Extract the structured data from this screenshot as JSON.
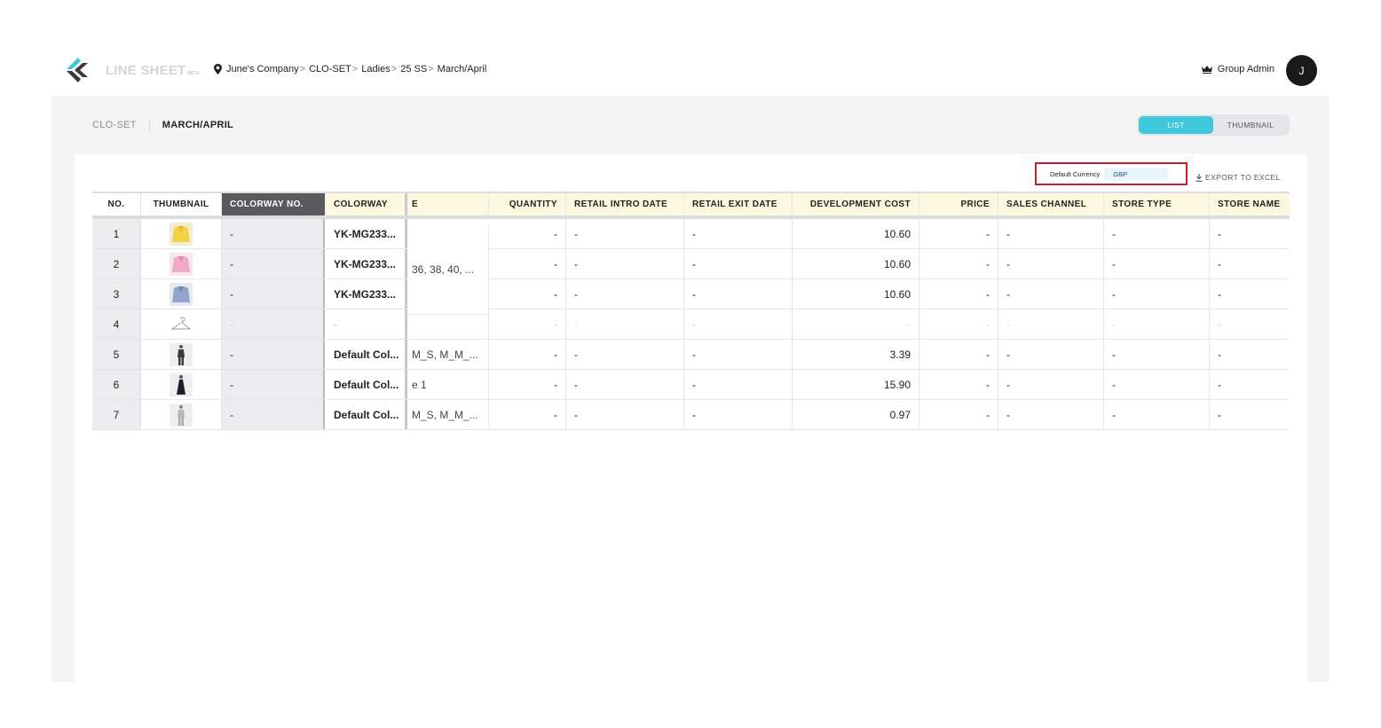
{
  "app": {
    "logo_text": "LINE SHEET",
    "logo_badge": "BETA"
  },
  "breadcrumb": [
    "June's Company",
    "CLO-SET",
    "Ladies",
    "25 SS",
    "March/April"
  ],
  "user": {
    "role": "Group Admin",
    "avatar_initial": "J"
  },
  "subnav": {
    "root": "CLO-SET",
    "current": "MARCH/APRIL"
  },
  "view_toggle": {
    "options": [
      "LIST",
      "THUMBNAIL"
    ],
    "selected": "LIST"
  },
  "currency": {
    "label": "Default Currency",
    "value": "GBP"
  },
  "export_label": "EXPORT TO EXCEL",
  "table": {
    "columns": [
      "NO.",
      "THUMBNAIL",
      "COLORWAY NO.",
      "COLORWAY",
      "E",
      "QUANTITY",
      "RETAIL INTRO DATE",
      "RETAIL EXIT DATE",
      "DEVELOPMENT COST",
      "PRICE",
      "SALES CHANNEL",
      "STORE TYPE",
      "STORE NAME"
    ],
    "merged_size_rows_1_3": "36, 38, 40, ...",
    "rows": [
      {
        "no": "1",
        "thumb": "yellow-jacket-thumbnail",
        "colorway_no": "-",
        "colorway": "YK-MG233...",
        "size": "",
        "quantity": "-",
        "intro": "-",
        "exit": "-",
        "dev_cost": "10.60",
        "price": "-",
        "sales": "-",
        "store_type": "-",
        "store_name": "-"
      },
      {
        "no": "2",
        "thumb": "pink-jacket-thumbnail",
        "colorway_no": "-",
        "colorway": "YK-MG233...",
        "size": "",
        "quantity": "-",
        "intro": "-",
        "exit": "-",
        "dev_cost": "10.60",
        "price": "-",
        "sales": "-",
        "store_type": "-",
        "store_name": "-"
      },
      {
        "no": "3",
        "thumb": "blue-jacket-thumbnail",
        "colorway_no": "-",
        "colorway": "YK-MG233...",
        "size": "",
        "quantity": "-",
        "intro": "-",
        "exit": "-",
        "dev_cost": "10.60",
        "price": "-",
        "sales": "-",
        "store_type": "-",
        "store_name": "-"
      },
      {
        "no": "4",
        "thumb": "hanger-placeholder-icon",
        "colorway_no": "-",
        "colorway": "-",
        "size": "",
        "quantity": "-",
        "intro": "-",
        "exit": "-",
        "dev_cost": "-",
        "price": "-",
        "sales": "-",
        "store_type": "-",
        "store_name": "-"
      },
      {
        "no": "5",
        "thumb": "suit-thumbnail",
        "colorway_no": "-",
        "colorway": "Default Col...",
        "size": "M_S, M_M_...",
        "quantity": "-",
        "intro": "-",
        "exit": "-",
        "dev_cost": "3.39",
        "price": "-",
        "sales": "-",
        "store_type": "-",
        "store_name": "-"
      },
      {
        "no": "6",
        "thumb": "dress-thumbnail",
        "colorway_no": "-",
        "colorway": "Default Col...",
        "size": "e 1",
        "quantity": "-",
        "intro": "-",
        "exit": "-",
        "dev_cost": "15.90",
        "price": "-",
        "sales": "-",
        "store_type": "-",
        "store_name": "-"
      },
      {
        "no": "7",
        "thumb": "light-suit-thumbnail",
        "colorway_no": "-",
        "colorway": "Default Col...",
        "size": "M_S, M_M_...",
        "quantity": "-",
        "intro": "-",
        "exit": "-",
        "dev_cost": "0.97",
        "price": "-",
        "sales": "-",
        "store_type": "-",
        "store_name": "-"
      }
    ]
  }
}
